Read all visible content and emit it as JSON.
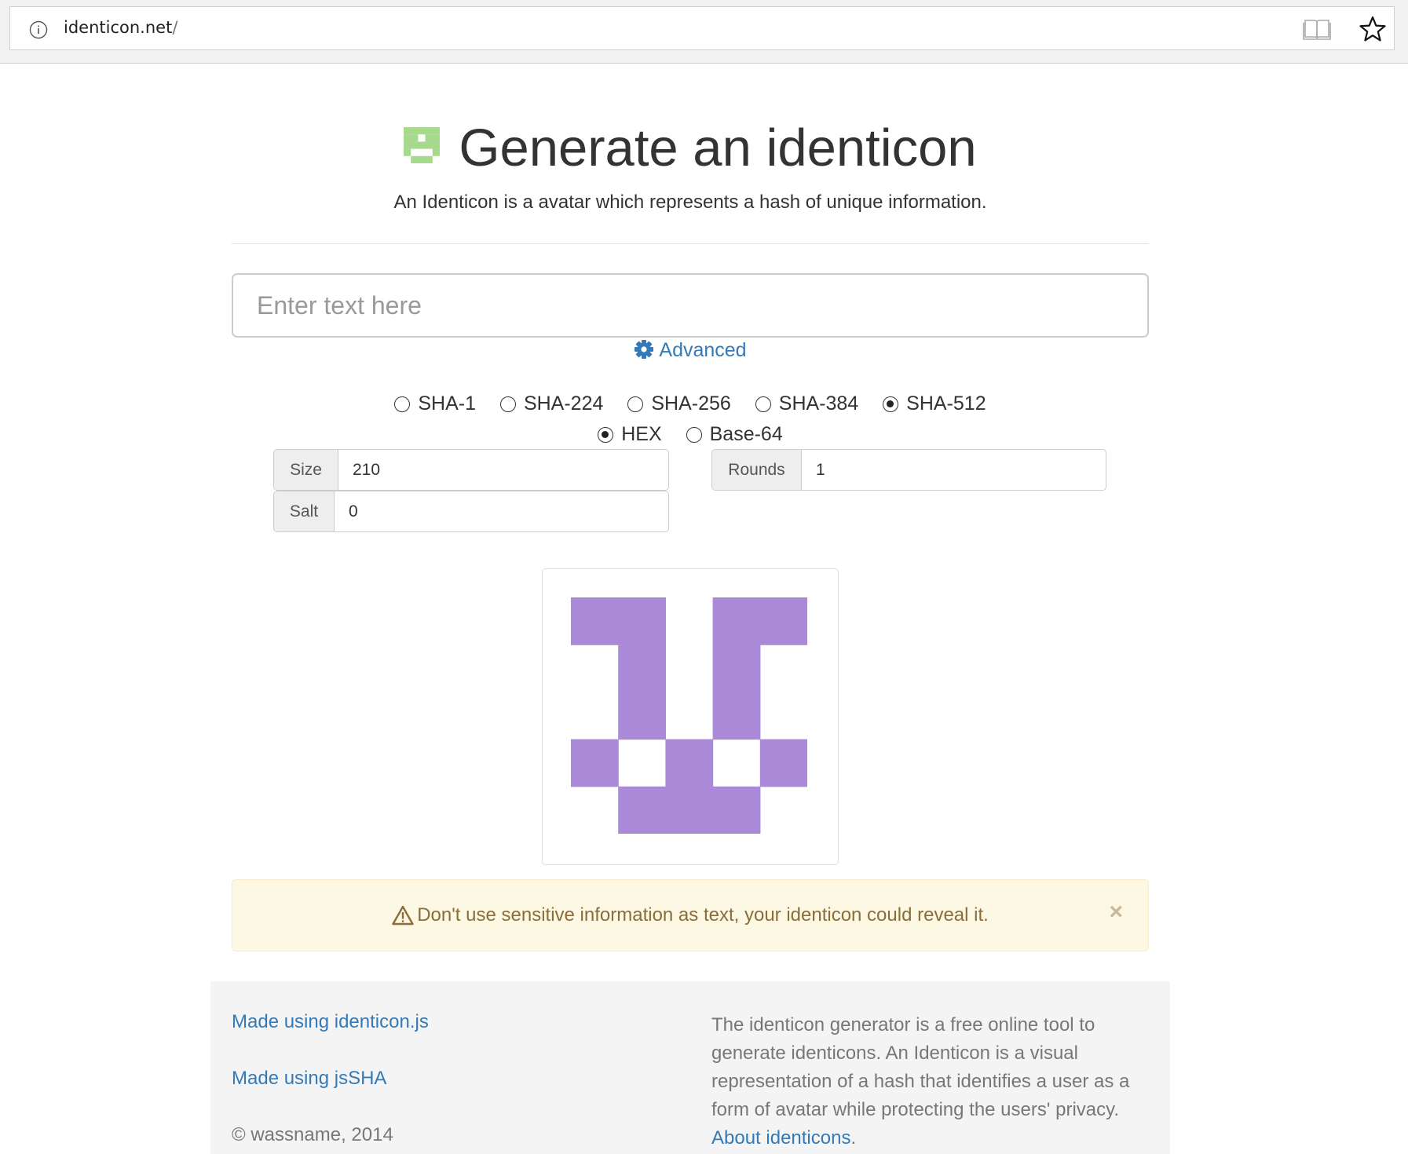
{
  "browser": {
    "url_host": "identicon.net",
    "url_path": "/",
    "icons": [
      "info-icon",
      "reading-view-icon",
      "favorite-star-icon"
    ]
  },
  "header": {
    "logo_icon": "identicon-logo-icon",
    "logo_color": "#a6d98b",
    "title": "Generate an identicon",
    "subtitle": "An Identicon is a avatar which represents a hash of unique information."
  },
  "input": {
    "placeholder": "Enter text here",
    "value": ""
  },
  "advanced": {
    "icon": "gear-icon",
    "label": "Advanced"
  },
  "hash_options": [
    {
      "label": "SHA-1",
      "checked": false
    },
    {
      "label": "SHA-224",
      "checked": false
    },
    {
      "label": "SHA-256",
      "checked": false
    },
    {
      "label": "SHA-384",
      "checked": false
    },
    {
      "label": "SHA-512",
      "checked": true
    }
  ],
  "encoding_options": [
    {
      "label": "HEX",
      "checked": true
    },
    {
      "label": "Base-64",
      "checked": false
    }
  ],
  "params": {
    "size_label": "Size",
    "size_value": "210",
    "rounds_label": "Rounds",
    "rounds_value": "1",
    "salt_label": "Salt",
    "salt_value": "0"
  },
  "identicon": {
    "color": "#aa8ad8",
    "grid": [
      [
        1,
        1,
        0,
        1,
        1
      ],
      [
        0,
        1,
        0,
        1,
        0
      ],
      [
        0,
        1,
        0,
        1,
        0
      ],
      [
        1,
        0,
        1,
        0,
        1
      ],
      [
        0,
        1,
        1,
        1,
        0
      ]
    ]
  },
  "alert": {
    "icon": "warning-icon",
    "text": "Don't use sensitive information as text, your identicon could reveal it.",
    "close": "×"
  },
  "footer": {
    "link1": "Made using identicon.js",
    "link2": "Made using jsSHA",
    "copyright": "© wassname, 2014",
    "about_text": "The identicon generator is a free online tool to generate identicons. An Identicon is a visual representation of a hash that identifies a user as a form of avatar while protecting the users' privacy.",
    "about_link": "About identicons",
    "about_end": "."
  }
}
